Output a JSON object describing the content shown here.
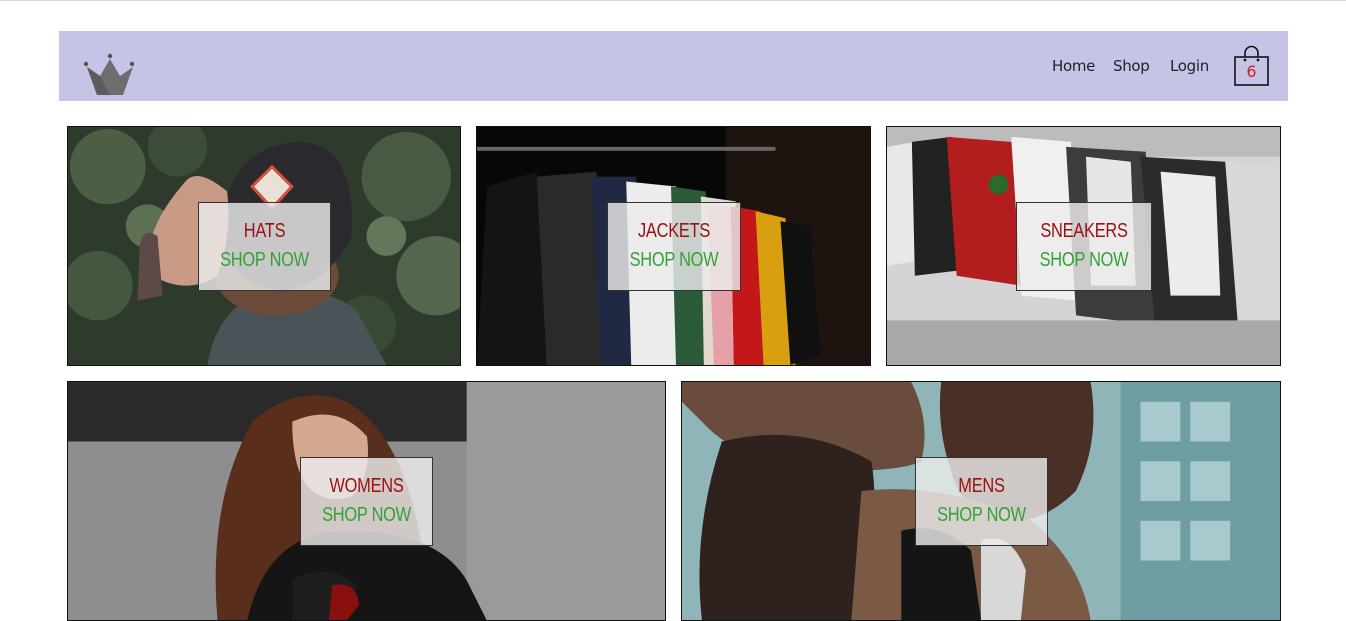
{
  "nav": {
    "logo_icon": "crown-icon",
    "links": [
      "Home",
      "Shop",
      "Login"
    ],
    "cart_icon": "shopping-bag-icon",
    "cart_count": "6"
  },
  "categories": [
    {
      "title": "HATS",
      "cta": "SHOP NOW"
    },
    {
      "title": "JACKETS",
      "cta": "SHOP NOW"
    },
    {
      "title": "SNEAKERS",
      "cta": "SHOP NOW"
    },
    {
      "title": "WOMENS",
      "cta": "SHOP NOW"
    },
    {
      "title": "MENS",
      "cta": "SHOP NOW"
    }
  ],
  "colors": {
    "header_bg": "#c5c4e6",
    "title": "#9b1010",
    "cta": "#35a035",
    "cart_count": "#d02020"
  }
}
